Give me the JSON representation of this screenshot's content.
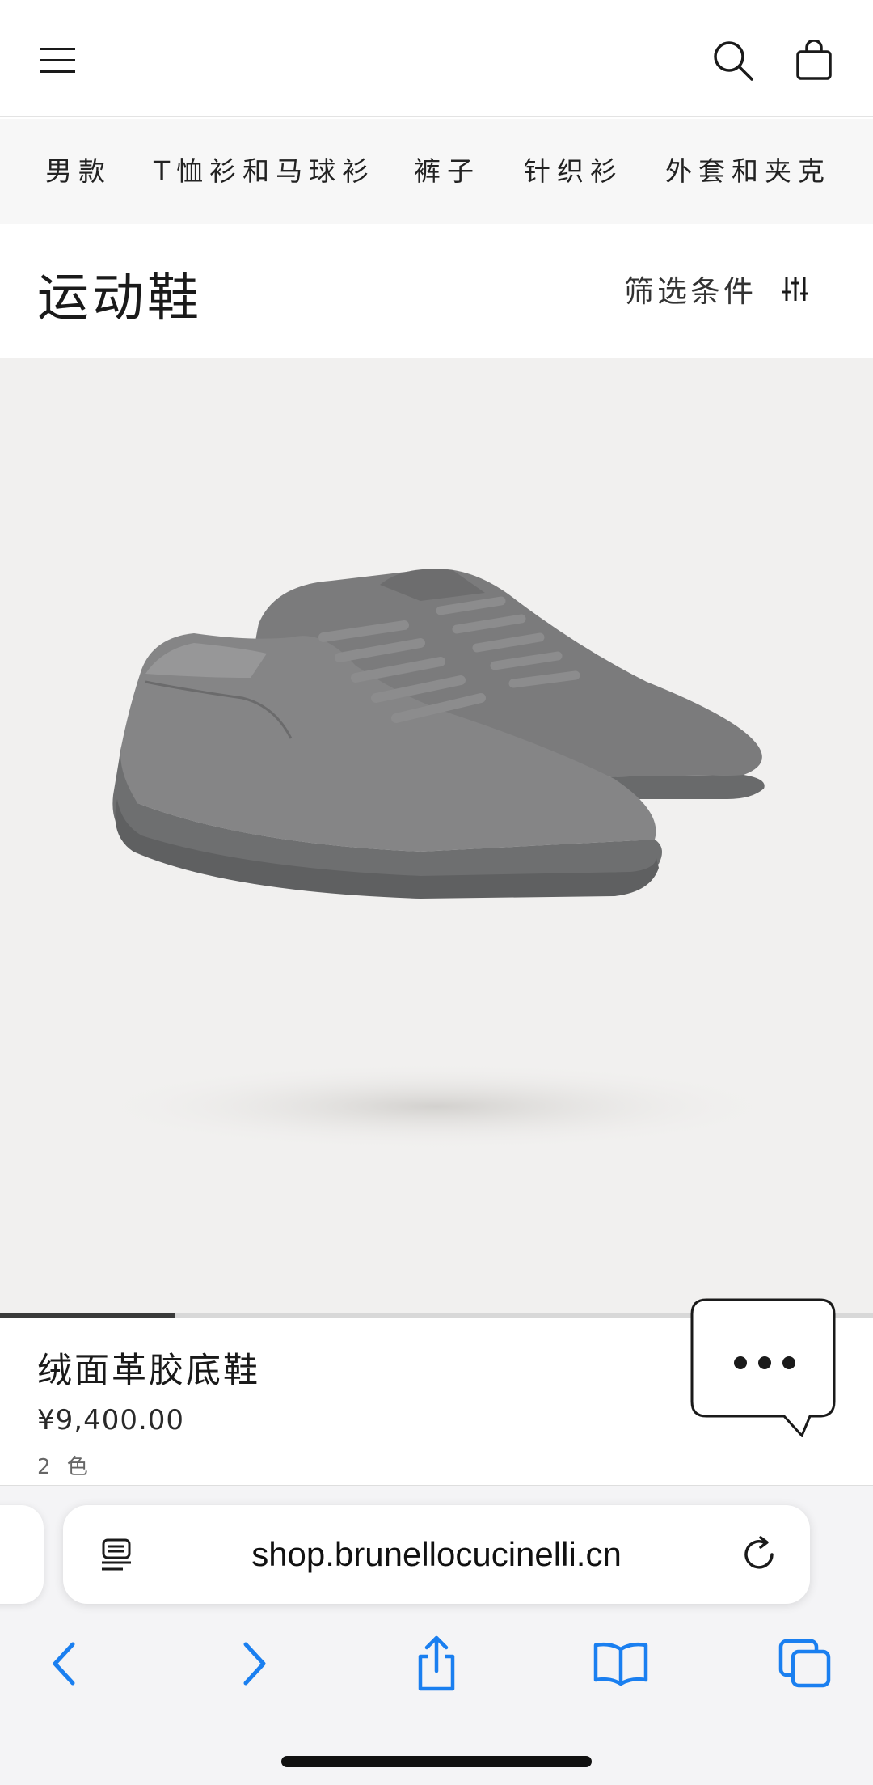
{
  "header": {
    "menu_icon": "hamburger-menu-icon",
    "search_icon": "search-icon",
    "bag_icon": "shopping-bag-icon"
  },
  "category_nav": {
    "items": [
      {
        "label": "男款"
      },
      {
        "label": "T恤衫和马球衫"
      },
      {
        "label": "裤子"
      },
      {
        "label": "针织衫"
      },
      {
        "label": "外套和夹克"
      }
    ]
  },
  "page": {
    "title": "运动鞋",
    "filter_label": "筛选条件",
    "filter_icon": "sliders-icon"
  },
  "product": {
    "image_alt": "grey suede sneakers",
    "name": "绒面革胶底鞋",
    "price": "¥9,400.00",
    "colors": "2 色",
    "carousel_progress": 0.2
  },
  "chat": {
    "icon": "chat-bubble-icon"
  },
  "browser": {
    "url": "shop.brunellocucinelli.cn",
    "reader_icon": "reader-mode-icon",
    "reload_icon": "reload-icon",
    "toolbar": {
      "back_icon": "back-icon",
      "forward_icon": "forward-icon",
      "share_icon": "share-icon",
      "bookmarks_icon": "bookmarks-icon",
      "tabs_icon": "tabs-icon"
    },
    "accent_color": "#1a7ff0"
  }
}
